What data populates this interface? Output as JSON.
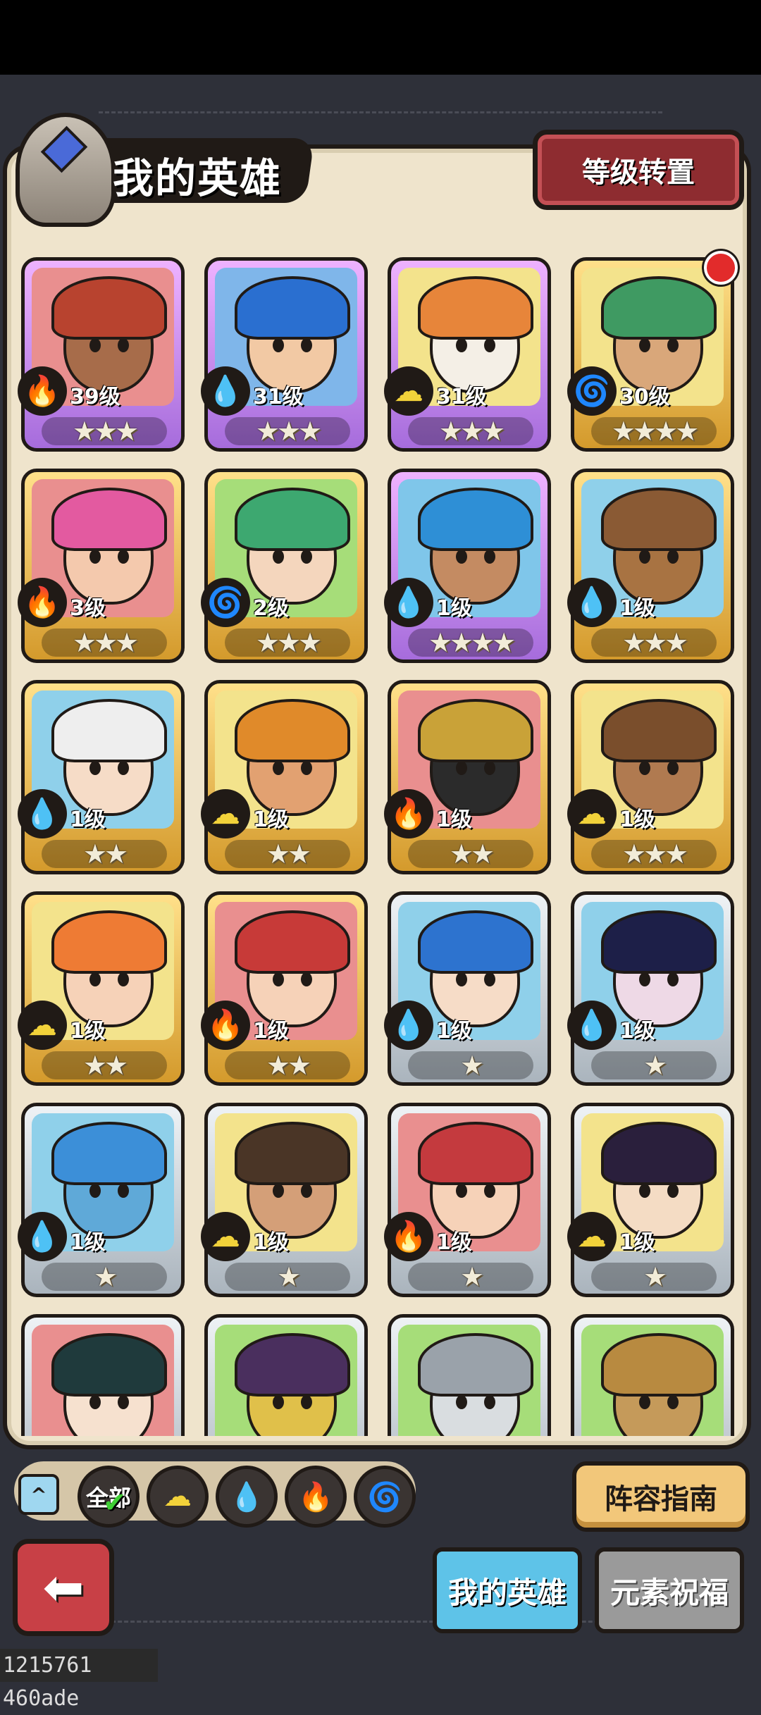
{
  "header": {
    "title": "我的英雄",
    "level_transfer_label": "等级转置"
  },
  "element_icons": {
    "fire": "🔥",
    "water": "💧",
    "earth": "☁",
    "wind": "🌀"
  },
  "heroes": [
    {
      "level_text": "39级",
      "stars": 3,
      "element": "fire",
      "frame": "purple",
      "hair": "#b8432f",
      "skin": "#a76c4a",
      "bg": "#e98f8f",
      "new": false
    },
    {
      "level_text": "31级",
      "stars": 3,
      "element": "water",
      "frame": "purple",
      "hair": "#2a6fd0",
      "skin": "#f2c9a4",
      "bg": "#7fb6ea",
      "new": false
    },
    {
      "level_text": "31级",
      "stars": 3,
      "element": "earth",
      "frame": "purple",
      "hair": "#e7853a",
      "skin": "#f4efe6",
      "bg": "#f3e38c",
      "new": false
    },
    {
      "level_text": "30级",
      "stars": 4,
      "element": "wind",
      "frame": "gold",
      "hair": "#3f9a62",
      "skin": "#d9a77a",
      "bg": "#f3e38c",
      "new": true
    },
    {
      "level_text": "3级",
      "stars": 3,
      "element": "fire",
      "frame": "gold",
      "hair": "#e35aa0",
      "skin": "#f4c9ad",
      "bg": "#e98f8f",
      "new": false
    },
    {
      "level_text": "2级",
      "stars": 3,
      "element": "wind",
      "frame": "gold",
      "hair": "#3da870",
      "skin": "#f4d6bd",
      "bg": "#a6dd79",
      "new": false
    },
    {
      "level_text": "1级",
      "stars": 4,
      "element": "water",
      "frame": "purple",
      "hair": "#2e8fd6",
      "skin": "#c48b62",
      "bg": "#7fc6ea",
      "new": false
    },
    {
      "level_text": "1级",
      "stars": 3,
      "element": "water",
      "frame": "gold",
      "hair": "#8a5a34",
      "skin": "#a87342",
      "bg": "#8fd0ea",
      "new": false
    },
    {
      "level_text": "1级",
      "stars": 2,
      "element": "water",
      "frame": "gold",
      "hair": "#eeeeee",
      "skin": "#f6dcc7",
      "bg": "#8fd0ea",
      "new": false
    },
    {
      "level_text": "1级",
      "stars": 2,
      "element": "earth",
      "frame": "gold",
      "hair": "#e08a2a",
      "skin": "#e2a171",
      "bg": "#f3e38c",
      "new": false
    },
    {
      "level_text": "1级",
      "stars": 2,
      "element": "fire",
      "frame": "gold",
      "hair": "#c9a238",
      "skin": "#2b2b2b",
      "bg": "#e98f8f",
      "new": false
    },
    {
      "level_text": "1级",
      "stars": 3,
      "element": "earth",
      "frame": "gold",
      "hair": "#7a4e2c",
      "skin": "#b07a50",
      "bg": "#f3e38c",
      "new": false
    },
    {
      "level_text": "1级",
      "stars": 2,
      "element": "earth",
      "frame": "gold",
      "hair": "#ee7b34",
      "skin": "#f6d2b8",
      "bg": "#f3e38c",
      "new": false
    },
    {
      "level_text": "1级",
      "stars": 2,
      "element": "fire",
      "frame": "gold",
      "hair": "#c73a38",
      "skin": "#f6d2b8",
      "bg": "#e98f8f",
      "new": false
    },
    {
      "level_text": "1级",
      "stars": 1,
      "element": "water",
      "frame": "silver",
      "hair": "#2d73cf",
      "skin": "#f6dcc7",
      "bg": "#8fd0ea",
      "new": false
    },
    {
      "level_text": "1级",
      "stars": 1,
      "element": "water",
      "frame": "silver",
      "hair": "#1d1f48",
      "skin": "#eed9e6",
      "bg": "#8fd0ea",
      "new": false
    },
    {
      "level_text": "1级",
      "stars": 1,
      "element": "water",
      "frame": "silver",
      "hair": "#3c8fd8",
      "skin": "#5fa9d8",
      "bg": "#8fd0ea",
      "new": false
    },
    {
      "level_text": "1级",
      "stars": 1,
      "element": "earth",
      "frame": "silver",
      "hair": "#4a3526",
      "skin": "#d49f78",
      "bg": "#f3e38c",
      "new": false
    },
    {
      "level_text": "1级",
      "stars": 1,
      "element": "fire",
      "frame": "silver",
      "hair": "#c43a3e",
      "skin": "#f6d2b8",
      "bg": "#e98f8f",
      "new": false
    },
    {
      "level_text": "1级",
      "stars": 1,
      "element": "earth",
      "frame": "silver",
      "hair": "#2a1f3c",
      "skin": "#f4dcc4",
      "bg": "#f3e38c",
      "new": false
    },
    {
      "level_text": "",
      "stars": 0,
      "element": "fire",
      "frame": "silver",
      "hair": "#1f3a3c",
      "skin": "#f6e1cf",
      "bg": "#e98f8f",
      "new": false
    },
    {
      "level_text": "",
      "stars": 0,
      "element": "wind",
      "frame": "silver",
      "hair": "#4a2f5e",
      "skin": "#e0c04a",
      "bg": "#a6dd79",
      "new": false
    },
    {
      "level_text": "",
      "stars": 0,
      "element": "earth",
      "frame": "silver",
      "hair": "#9aa2aa",
      "skin": "#d9dde0",
      "bg": "#a6dd79",
      "new": false
    },
    {
      "level_text": "",
      "stars": 0,
      "element": "wind",
      "frame": "silver",
      "hair": "#b88a40",
      "skin": "#c59a5a",
      "bg": "#a6dd79",
      "new": false
    }
  ],
  "filters": {
    "all_label": "全部",
    "items": [
      "earth",
      "water",
      "fire",
      "wind"
    ],
    "selected": "all"
  },
  "bottom": {
    "guide_label": "阵容指南",
    "tab_my_heroes": "我的英雄",
    "tab_blessing": "元素祝福",
    "active_tab": "my_heroes"
  },
  "footer_id": "1215761 460ade"
}
